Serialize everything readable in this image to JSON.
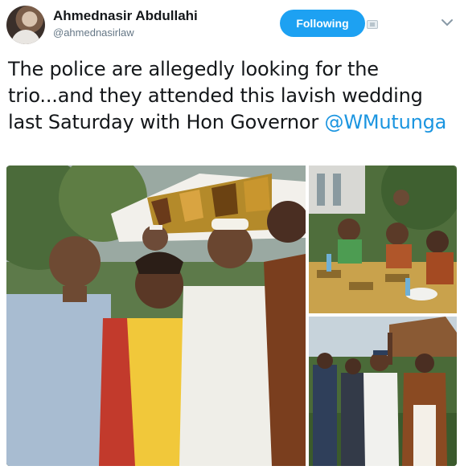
{
  "tweet": {
    "author_name": "Ahmednasir Abdullahi",
    "author_handle": "@ahmednasirlaw",
    "follow_label": "Following",
    "text": "The police are allegedly looking for the trio...and they attended this lavish wedding last Saturday with Hon Governor ",
    "mention": "@WMutunga"
  },
  "icons": {
    "avatar": "profile-photo",
    "notifications": "notification-bell-icon",
    "more": "chevron-down-icon"
  },
  "media": {
    "photos": [
      "wedding-group-photo",
      "wedding-dining-table-photo",
      "wedding-guests-outdoor-photo"
    ]
  },
  "colors": {
    "accent": "#1da1f2",
    "mention": "#1b95e0",
    "text": "#14171a",
    "secondary": "#657786"
  }
}
